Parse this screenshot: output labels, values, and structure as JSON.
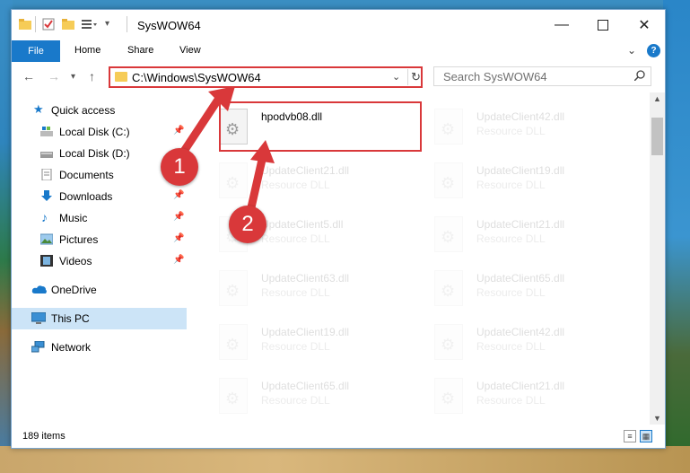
{
  "window": {
    "title": "SysWOW64",
    "minimize_icon": "minimize-icon",
    "maximize_icon": "maximize-icon",
    "close_icon": "close-icon"
  },
  "ribbon": {
    "tabs": [
      {
        "label": "File"
      },
      {
        "label": "Home"
      },
      {
        "label": "Share"
      },
      {
        "label": "View"
      }
    ]
  },
  "nav": {
    "address": "C:\\Windows\\SysWOW64",
    "search_placeholder": "Search SysWOW64"
  },
  "sidebar": {
    "items": [
      {
        "label": "Quick access",
        "icon": "star-icon"
      },
      {
        "label": "Local Disk (C:)",
        "icon": "drive-icon",
        "pinned": true
      },
      {
        "label": "Local Disk (D:)",
        "icon": "drive-icon"
      },
      {
        "label": "Documents",
        "icon": "documents-icon",
        "pinned": true
      },
      {
        "label": "Downloads",
        "icon": "download-icon",
        "pinned": true
      },
      {
        "label": "Music",
        "icon": "music-icon",
        "pinned": true
      },
      {
        "label": "Pictures",
        "icon": "pictures-icon",
        "pinned": true
      },
      {
        "label": "Videos",
        "icon": "videos-icon",
        "pinned": true
      },
      {
        "label": "OneDrive",
        "icon": "cloud-icon"
      },
      {
        "label": "This PC",
        "icon": "computer-icon",
        "selected": true
      },
      {
        "label": "Network",
        "icon": "network-icon"
      }
    ]
  },
  "files": {
    "highlighted": {
      "name": "hpodvb08.dll",
      "type": ""
    },
    "left_column": [
      {
        "name": "UpdateClient21.dll",
        "type": "Resource DLL"
      },
      {
        "name": "UpdateClient5.dll",
        "type": "Resource DLL"
      },
      {
        "name": "UpdateClient63.dll",
        "type": "Resource DLL"
      },
      {
        "name": "UpdateClient19.dll",
        "type": "Resource DLL"
      },
      {
        "name": "UpdateClient65.dll",
        "type": "Resource DLL"
      }
    ],
    "right_column": [
      {
        "name": "UpdateClient42.dll",
        "type": "Resource DLL"
      },
      {
        "name": "UpdateClient19.dll",
        "type": "Resource DLL"
      },
      {
        "name": "UpdateClient21.dll",
        "type": "Resource DLL"
      },
      {
        "name": "UpdateClient65.dll",
        "type": "Resource DLL"
      },
      {
        "name": "UpdateClient42.dll",
        "type": "Resource DLL"
      },
      {
        "name": "UpdateClient21.dll",
        "type": "Resource DLL"
      }
    ]
  },
  "status": {
    "item_count": "189 items"
  },
  "annotations": {
    "badge1": "1",
    "badge2": "2",
    "color": "#d9383a"
  }
}
